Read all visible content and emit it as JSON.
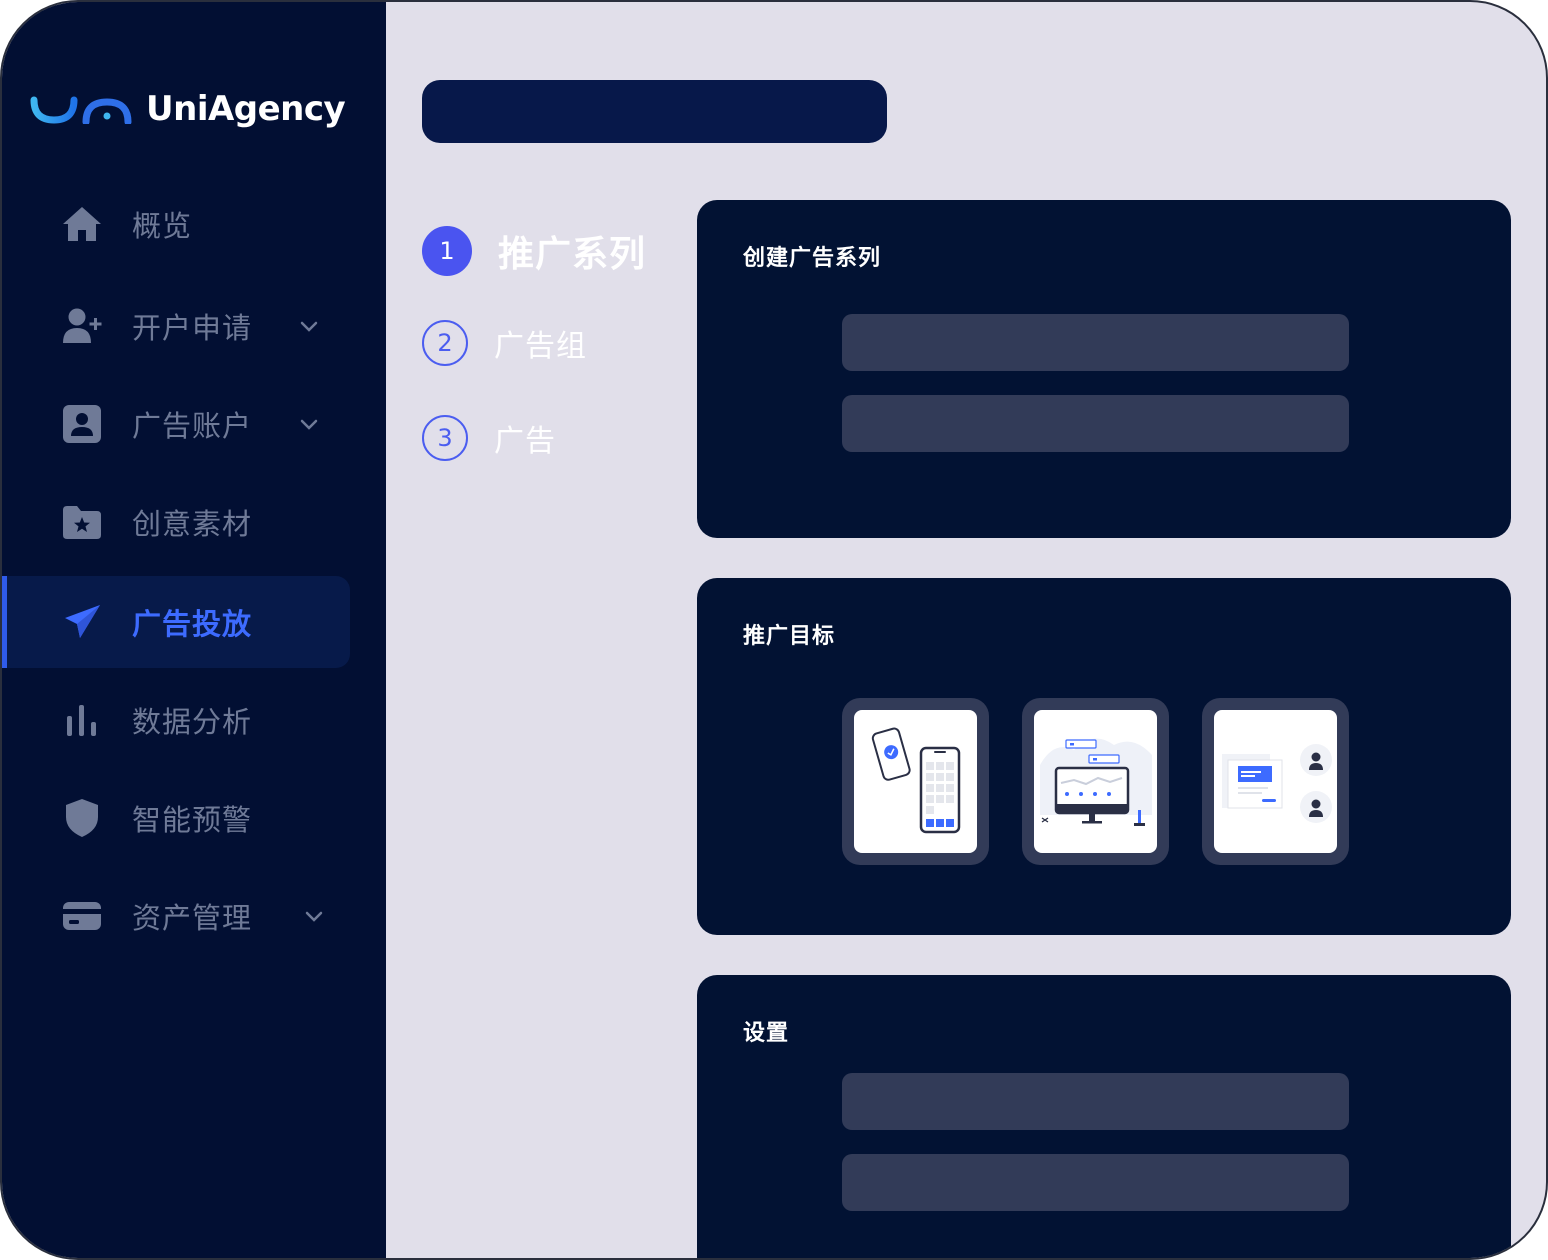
{
  "app": {
    "brand": "UniAgency"
  },
  "sidebar": {
    "items": [
      {
        "label": "概览",
        "icon": "home-icon"
      },
      {
        "label": "开户申请",
        "icon": "user-plus-icon",
        "expandable": true
      },
      {
        "label": "广告账户",
        "icon": "account-card-icon",
        "expandable": true
      },
      {
        "label": "创意素材",
        "icon": "folder-star-icon"
      },
      {
        "label": "广告投放",
        "icon": "paper-plane-icon",
        "active": true
      },
      {
        "label": "数据分析",
        "icon": "bar-chart-icon"
      },
      {
        "label": "智能预警",
        "icon": "shield-icon"
      },
      {
        "label": "资产管理",
        "icon": "credit-card-icon",
        "expandable": true
      }
    ]
  },
  "steps": [
    {
      "number": "1",
      "label": "推广系列",
      "current": true
    },
    {
      "number": "2",
      "label": "广告组"
    },
    {
      "number": "3",
      "label": "广告"
    }
  ],
  "cards": {
    "create": {
      "title": "创建广告系列"
    },
    "objective": {
      "title": "推广目标",
      "options": [
        "mobile-app-illustration",
        "website-dashboard-illustration",
        "audience-illustration"
      ]
    },
    "settings": {
      "title": "设置"
    }
  },
  "colors": {
    "sidebar_bg": "#020f33",
    "main_bg": "#e1dfea",
    "card_bg": "#021233",
    "accent": "#3d6bff",
    "placeholder": "#323b58"
  }
}
